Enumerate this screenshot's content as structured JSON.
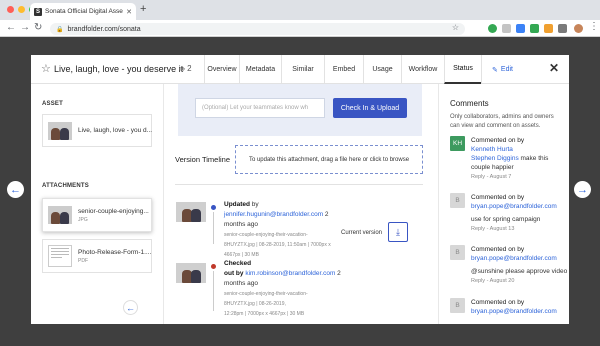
{
  "browser": {
    "tab_title": "Sonata Official Digital Assets |",
    "tab_favicon": "S",
    "url": "brandfolder.com/sonata",
    "traffic_colors": [
      "#ff5f57",
      "#febc2e",
      "#28c840"
    ],
    "extension_colors": [
      "#34a853",
      "#c4c4c4",
      "#3b82f6",
      "#34a853",
      "#f0a030",
      "#7a7a7a"
    ]
  },
  "modal": {
    "title": "Live, laugh, love - you deserve it",
    "version_count": "2",
    "tabs": [
      {
        "label": "Overview"
      },
      {
        "label": "Metadata"
      },
      {
        "label": "Similar"
      },
      {
        "label": "Embed"
      },
      {
        "label": "Usage"
      },
      {
        "label": "Workflow"
      },
      {
        "label": "Status"
      }
    ],
    "edit_label": "Edit"
  },
  "left": {
    "asset_label": "ASSET",
    "asset_name": "Live, laugh, love - you d...",
    "attachments_label": "ATTACHMENTS",
    "attachments": [
      {
        "name": "senior-couple-enjoying...",
        "type": "JPG"
      },
      {
        "name": "Photo-Release-Form-1....",
        "type": "PDF"
      }
    ]
  },
  "middle": {
    "checkin_placeholder": "(Optional) Let your teammates know wh",
    "checkin_button": "Check In & Upload",
    "version_timeline_label": "Version Timeline",
    "drop_zone_text": "To update this attachment, drag a file here or click to browse",
    "entries": [
      {
        "action": "Updated",
        "by_word": " by ",
        "user": "jennifer.hugunin@brandfolder.com",
        "version": " 2",
        "when": "months ago",
        "filename": "senior-couple-enjoying-their-vacation-",
        "details": "8HUYZTX.jpg  |  08-28-2019, 11:50am  |  7000px x",
        "details2": "4667px  |  30 MB",
        "current_label": "Current version"
      },
      {
        "action": "Checked",
        "out_by": "out by ",
        "user": "kim.robinson@brandfolder.com",
        "version": " 2",
        "when": "months ago",
        "filename": "senior-couple-enjoying-their-vacation-",
        "details": "8HUYZTX.jpg  |  08-26-2019,",
        "details2": "12:28pm  |  7000px x 4667px  |  30 MB"
      }
    ]
  },
  "right": {
    "title": "Comments",
    "description": "Only collaborators, admins and owners can view and comment on assets.",
    "comments": [
      {
        "initials": "KH",
        "head": "Commented on by",
        "user": "Kenneth Hurta",
        "mention": "Stephen Diggins",
        "text": " make this couple happier",
        "reply": "Reply - August 7"
      },
      {
        "initials": "B",
        "head": "Commented on by",
        "user": "bryan.pope@brandfolder.com",
        "text": "use for spring campaign",
        "reply": "Reply - August 13"
      },
      {
        "initials": "B",
        "head": "Commented on by",
        "user": "bryan.pope@brandfolder.com",
        "text": "@sunshine please approve video",
        "reply": "Reply - August 20"
      },
      {
        "initials": "B",
        "head": "Commented on by",
        "user": "bryan.pope@brandfolder.com"
      }
    ]
  }
}
